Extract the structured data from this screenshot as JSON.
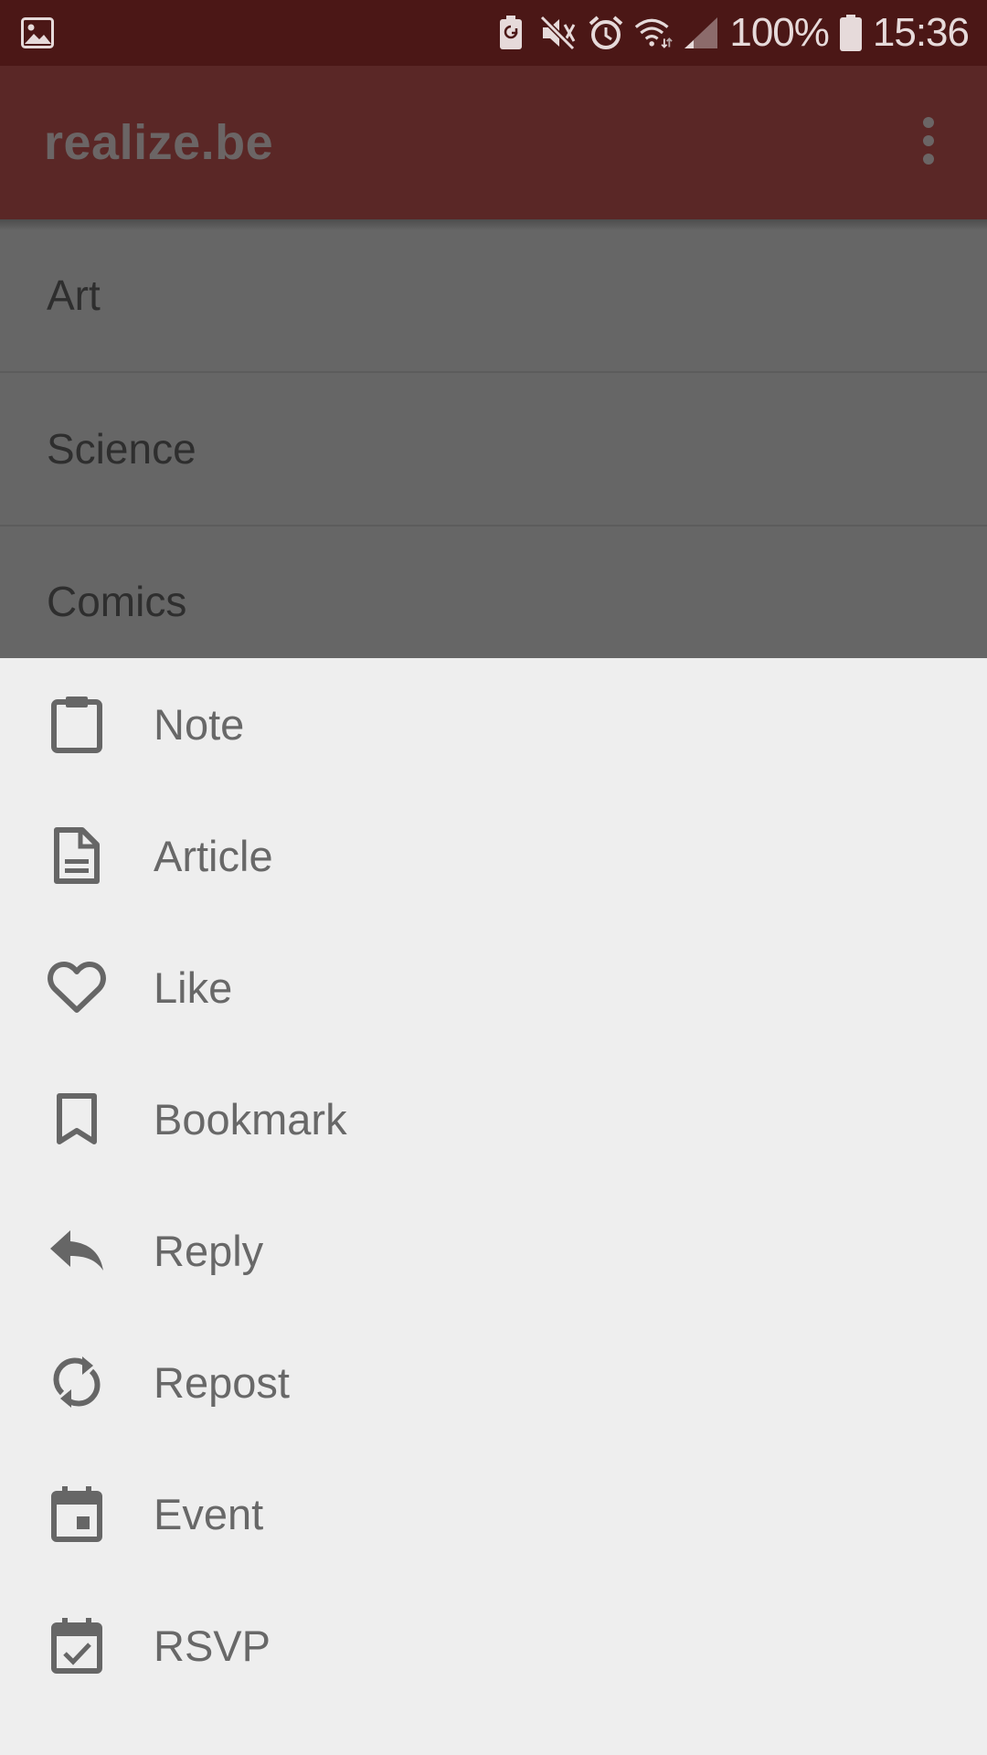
{
  "status_bar": {
    "battery_percent": "100%",
    "time": "15:36",
    "icons": [
      "gallery-icon",
      "battery-saver-icon",
      "mute-icon",
      "alarm-icon",
      "wifi-icon",
      "signal-icon",
      "battery-icon"
    ]
  },
  "app_bar": {
    "title": "realize.be",
    "overflow_icon": "more-vert-icon"
  },
  "categories": [
    {
      "label": "Art"
    },
    {
      "label": "Science"
    },
    {
      "label": "Comics"
    }
  ],
  "bottom_sheet": {
    "items": [
      {
        "label": "Note",
        "icon": "clipboard-icon"
      },
      {
        "label": "Article",
        "icon": "document-icon"
      },
      {
        "label": "Like",
        "icon": "heart-icon"
      },
      {
        "label": "Bookmark",
        "icon": "bookmark-icon"
      },
      {
        "label": "Reply",
        "icon": "reply-icon"
      },
      {
        "label": "Repost",
        "icon": "repost-icon"
      },
      {
        "label": "Event",
        "icon": "calendar-icon"
      },
      {
        "label": "RSVP",
        "icon": "calendar-check-icon"
      }
    ]
  },
  "colors": {
    "status_bar_bg": "#4b1716",
    "app_bar_bg": "#5a2726",
    "scrim_list_bg": "#666666",
    "sheet_bg": "#eeeeee",
    "icon_color": "#666666"
  }
}
